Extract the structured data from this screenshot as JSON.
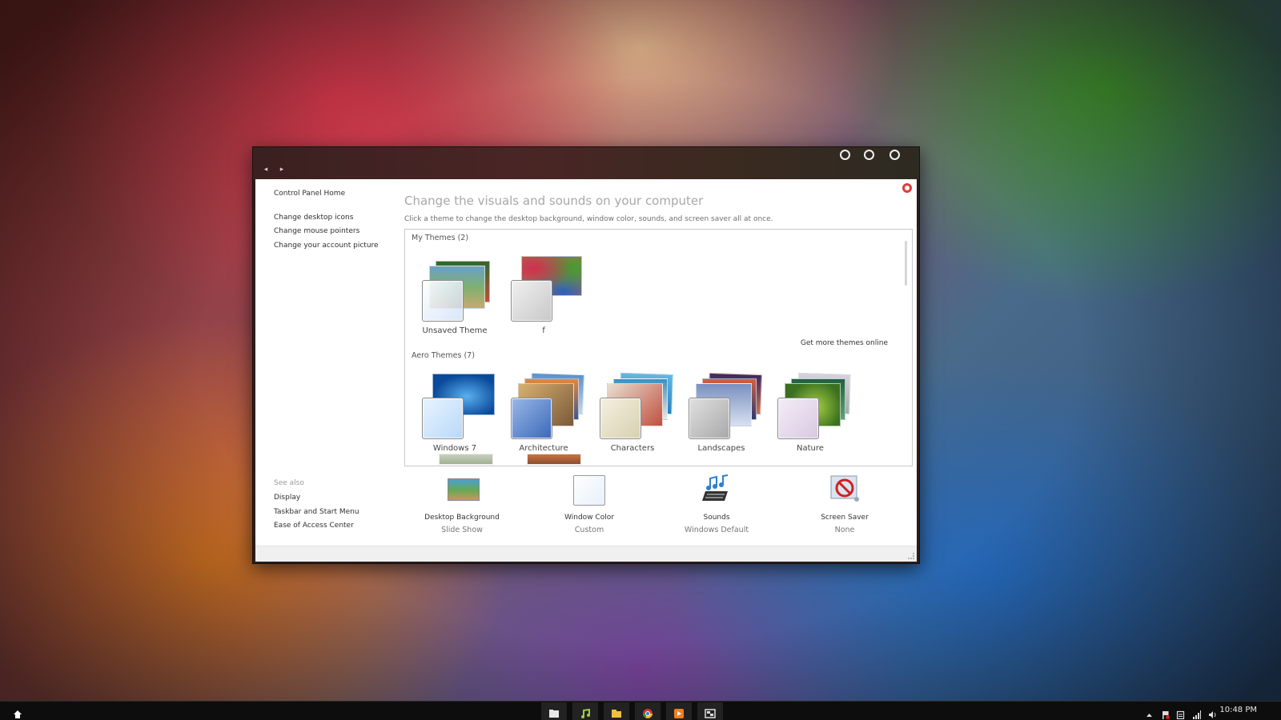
{
  "window": {
    "nav": {
      "back": "◂",
      "forward": "▸"
    },
    "left_pane": {
      "home": "Control Panel Home",
      "links": [
        "Change desktop icons",
        "Change mouse pointers",
        "Change your account picture"
      ],
      "see_also_title": "See also",
      "see_also": [
        "Display",
        "Taskbar and Start Menu",
        "Ease of Access Center"
      ]
    },
    "title": "Change the visuals and sounds on your computer",
    "subtitle": "Click a theme to change the desktop background, window color, sounds, and screen saver all at once.",
    "my_themes": {
      "title": "My Themes (2)",
      "items": [
        "Unsaved Theme",
        "f"
      ]
    },
    "get_more": "Get more themes online",
    "aero_themes": {
      "title": "Aero Themes (7)",
      "items": [
        "Windows 7",
        "Architecture",
        "Characters",
        "Landscapes",
        "Nature"
      ]
    },
    "settings": [
      {
        "label": "Desktop Background",
        "value": "Slide Show"
      },
      {
        "label": "Window Color",
        "value": "Custom"
      },
      {
        "label": "Sounds",
        "value": "Windows Default"
      },
      {
        "label": "Screen Saver",
        "value": "None"
      }
    ]
  },
  "taskbar": {
    "clock": "10:48 PM",
    "apps": [
      "explorer-icon",
      "music-icon",
      "folder-icon",
      "chrome-icon",
      "media-player-icon",
      "screen-icon"
    ]
  }
}
